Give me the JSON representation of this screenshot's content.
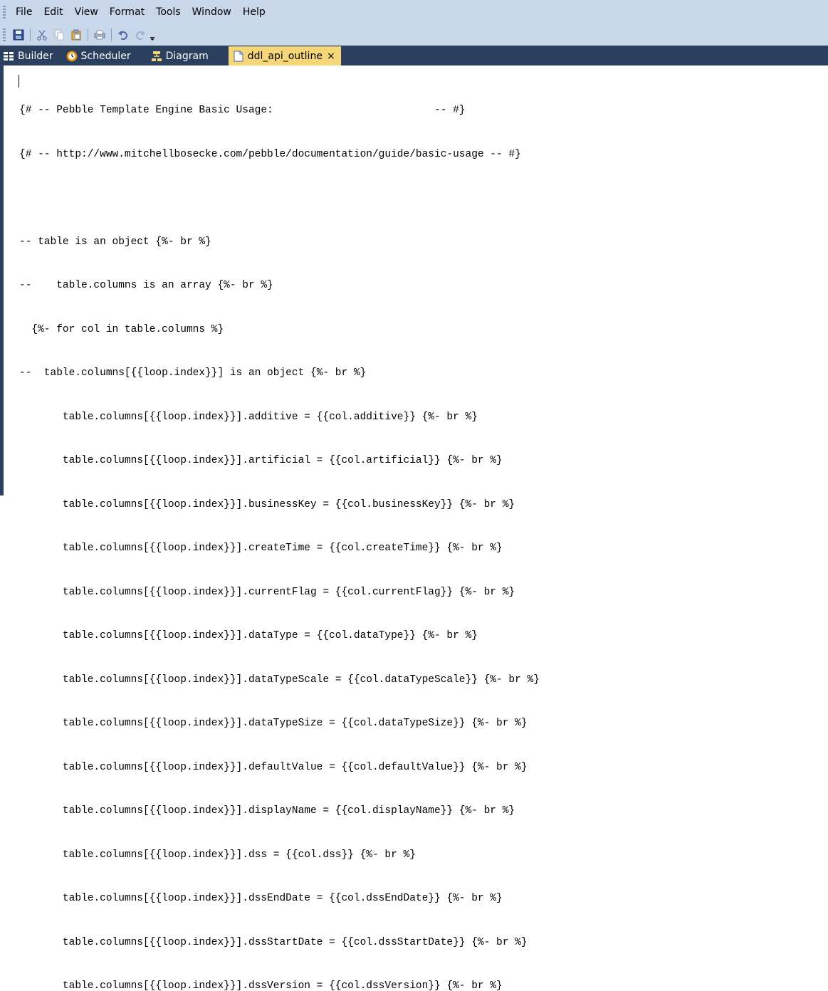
{
  "menu": {
    "items": [
      "File",
      "Edit",
      "View",
      "Format",
      "Tools",
      "Window",
      "Help"
    ]
  },
  "toolbar": {
    "buttons": [
      {
        "icon": "save-icon"
      },
      {
        "icon": "cut-icon"
      },
      {
        "icon": "copy-icon"
      },
      {
        "icon": "paste-icon"
      },
      {
        "icon": "print-icon"
      },
      {
        "icon": "undo-icon"
      },
      {
        "icon": "redo-icon"
      },
      {
        "icon": "overflow-icon"
      }
    ]
  },
  "tabs": [
    {
      "label": "Builder",
      "icon": "builder-icon",
      "active": false
    },
    {
      "label": "Scheduler",
      "icon": "scheduler-icon",
      "active": false
    },
    {
      "label": "Diagram",
      "icon": "diagram-icon",
      "active": false
    },
    {
      "label": "ddl_api_outline",
      "icon": "document-icon",
      "active": true,
      "close": "×"
    }
  ],
  "editor": {
    "lines": [
      "{# -- Pebble Template Engine Basic Usage:                          -- #}",
      "{# -- http://www.mitchellbosecke.com/pebble/documentation/guide/basic-usage -- #}",
      "",
      "-- table is an object {%- br %}",
      "--    table.columns is an array {%- br %}",
      "  {%- for col in table.columns %}",
      "--  table.columns[{{loop.index}}] is an object {%- br %}",
      "       table.columns[{{loop.index}}].additive = {{col.additive}} {%- br %}",
      "       table.columns[{{loop.index}}].artificial = {{col.artificial}} {%- br %}",
      "       table.columns[{{loop.index}}].businessKey = {{col.businessKey}} {%- br %}",
      "       table.columns[{{loop.index}}].createTime = {{col.createTime}} {%- br %}",
      "       table.columns[{{loop.index}}].currentFlag = {{col.currentFlag}} {%- br %}",
      "       table.columns[{{loop.index}}].dataType = {{col.dataType}} {%- br %}",
      "       table.columns[{{loop.index}}].dataTypeScale = {{col.dataTypeScale}} {%- br %}",
      "       table.columns[{{loop.index}}].dataTypeSize = {{col.dataTypeSize}} {%- br %}",
      "       table.columns[{{loop.index}}].defaultValue = {{col.defaultValue}} {%- br %}",
      "       table.columns[{{loop.index}}].displayName = {{col.displayName}} {%- br %}",
      "       table.columns[{{loop.index}}].dss = {{col.dss}} {%- br %}",
      "       table.columns[{{loop.index}}].dssEndDate = {{col.dssEndDate}} {%- br %}",
      "       table.columns[{{loop.index}}].dssStartDate = {{col.dssStartDate}} {%- br %}",
      "       table.columns[{{loop.index}}].dssVersion = {{col.dssVersion}} {%- br %}"
    ]
  }
}
